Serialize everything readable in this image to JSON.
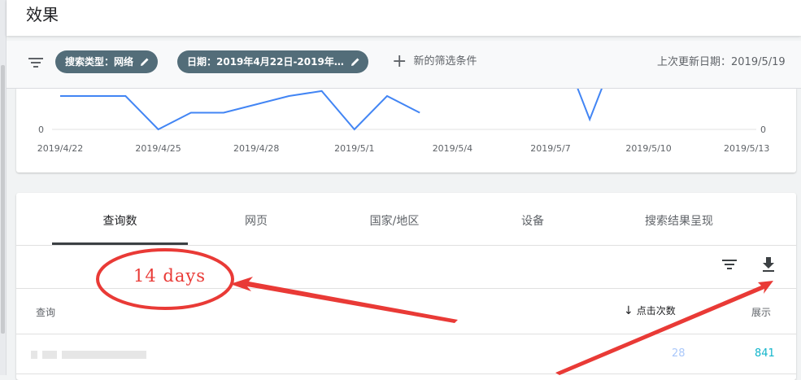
{
  "page": {
    "title": "效果"
  },
  "filters": {
    "search_type_chip": "搜索类型：网络",
    "date_chip": "日期：2019年4月22日-2019年…",
    "new_filter": "新的筛选条件",
    "last_updated": "上次更新日期：2019/5/19"
  },
  "chart_data": {
    "type": "line",
    "x": [
      "2019/4/22",
      "2019/4/23",
      "2019/4/24",
      "2019/4/25",
      "2019/4/26",
      "2019/4/27",
      "2019/4/28",
      "2019/4/29",
      "2019/4/30",
      "2019/5/1",
      "2019/5/2",
      "2019/5/3",
      "2019/5/4",
      "2019/5/5",
      "2019/5/6",
      "2019/5/7",
      "2019/5/8",
      "2019/5/9",
      "2019/5/10",
      "2019/5/11",
      "2019/5/12",
      "2019/5/13"
    ],
    "tick_labels": [
      "2019/4/22",
      "2019/4/25",
      "2019/4/28",
      "2019/5/1",
      "2019/5/4",
      "2019/5/7",
      "2019/5/10",
      "2019/5/13"
    ],
    "y_left_tick": "0",
    "y_right_tick": "0",
    "series": [
      {
        "color": "#4285f4",
        "values": [
          2,
          2,
          2,
          0,
          1,
          1,
          1.5,
          2,
          2.3,
          0,
          2,
          1
        ]
      }
    ],
    "partial_segment": {
      "color": "#4285f4",
      "values": [
        2.6,
        0.6,
        2.6
      ]
    },
    "grid": true
  },
  "tabs": {
    "queries": "查询数",
    "pages": "网页",
    "countries": "国家/地区",
    "devices": "设备",
    "search_appearance": "搜索结果呈现"
  },
  "table": {
    "col_query": "查询",
    "col_clicks": "点击次数",
    "col_impressions": "展示",
    "rows": [
      {
        "clicks": "28",
        "impressions": "841"
      }
    ]
  },
  "annotation": {
    "label": "14 days",
    "color": "#e93a36"
  },
  "icons": {
    "filter": "filter-icon",
    "edit": "pencil-icon",
    "add": "plus-icon",
    "download": "download-icon",
    "sort": "arrow-down-icon"
  }
}
